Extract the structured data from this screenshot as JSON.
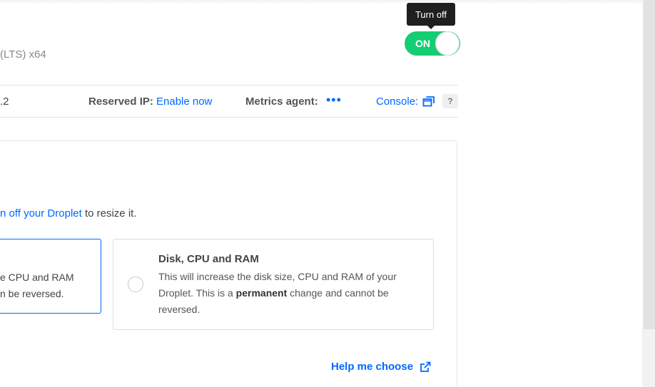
{
  "header": {
    "os_label": "(LTS) x64"
  },
  "power": {
    "tooltip": "Turn off",
    "toggle_label": "ON"
  },
  "info_bar": {
    "ip_tail": ".2",
    "reserved_ip_label": "Reserved IP:",
    "reserved_ip_link": "Enable now",
    "metrics_label": "Metrics agent:",
    "metrics_value": "•••",
    "console_label": "Console:",
    "help_badge": "?"
  },
  "resize": {
    "note_link": "n off your Droplet",
    "note_rest": " to resize it.",
    "left_card": {
      "line1": "e CPU and RAM",
      "line2": "n be reversed."
    },
    "right_card": {
      "title": "Disk, CPU and RAM",
      "desc_before": "This will increase the disk size, CPU and RAM of your Droplet. This is a ",
      "desc_bold": "permanent",
      "desc_after": " change and cannot be reversed."
    },
    "help_link": "Help me choose"
  },
  "colors": {
    "accent": "#0069ff",
    "toggle_on": "#15cd72"
  }
}
